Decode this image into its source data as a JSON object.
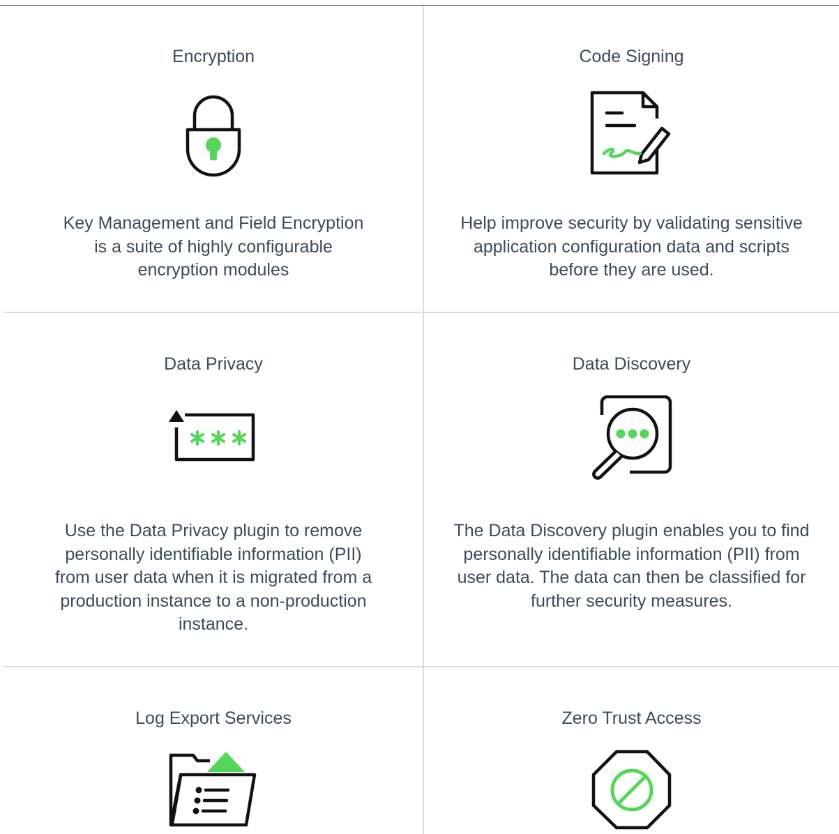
{
  "features": [
    {
      "title": "Encryption",
      "icon": "padlock-icon",
      "description": "Key Management and Field Encryption is a suite of highly configurable encryption modules"
    },
    {
      "title": "Code Signing",
      "icon": "signed-document-icon",
      "description": "Help improve security by validating sensitive application configuration data and scripts before they are used."
    },
    {
      "title": "Data Privacy",
      "icon": "masked-password-icon",
      "description": "Use the Data Privacy plugin to remove personally identifiable information (PII) from user data when it is migrated from a production instance to a non-production instance."
    },
    {
      "title": "Data Discovery",
      "icon": "magnifier-search-icon",
      "description": "The Data Discovery plugin enables you to find personally identifiable information (PII) from user data. The data can then be classified for further security measures."
    },
    {
      "title": "Log Export Services",
      "icon": "folder-export-icon",
      "description": ""
    },
    {
      "title": "Zero Trust Access",
      "icon": "blocked-octagon-icon",
      "description": ""
    }
  ],
  "colors": {
    "accent": "#54d65a",
    "text": "#3b4a5c",
    "icon_stroke": "#111111",
    "divider": "#dcdcdc"
  }
}
